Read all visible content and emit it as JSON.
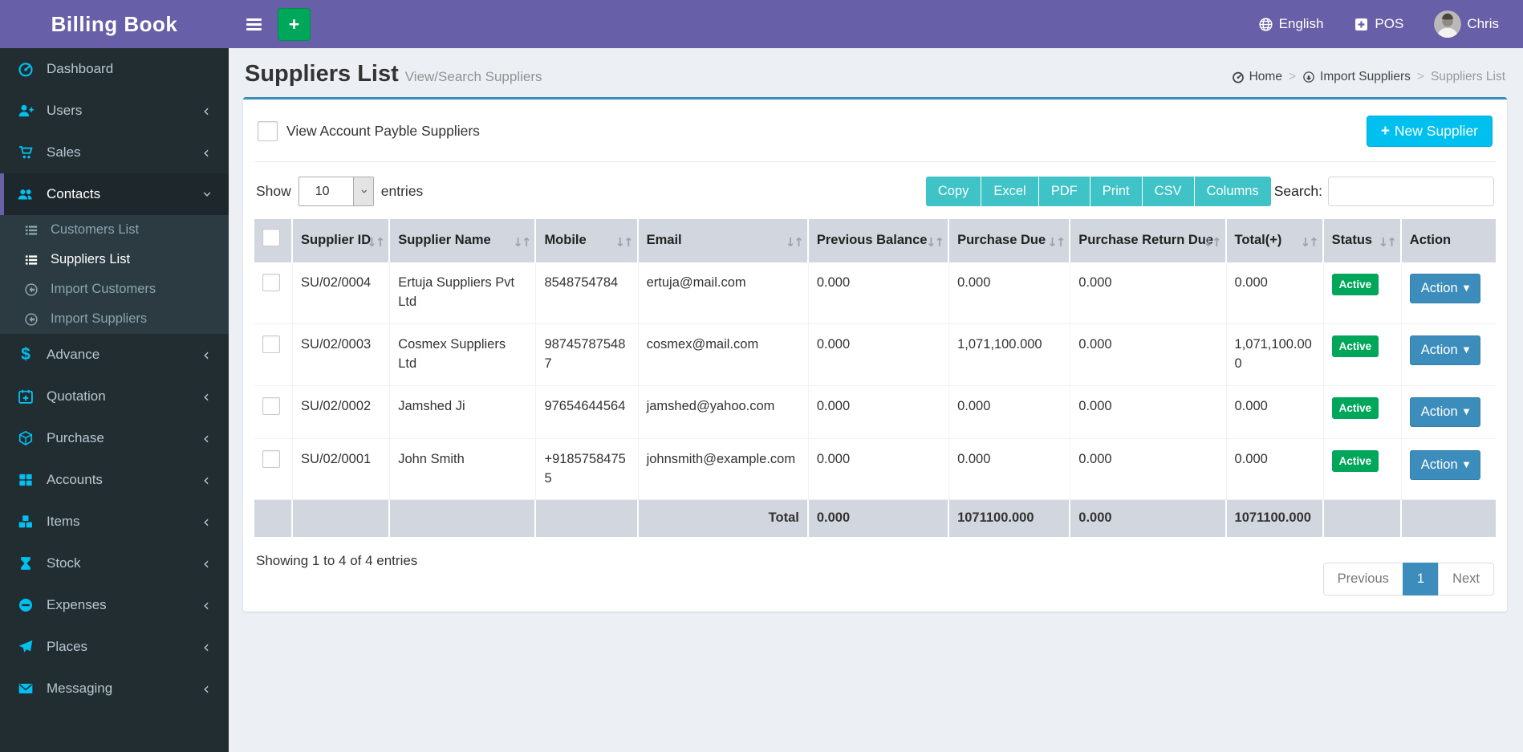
{
  "app": {
    "title": "Billing Book"
  },
  "navbar": {
    "quick_add_label": "+",
    "language": "English",
    "pos": "POS",
    "user": "Chris"
  },
  "sidebar": {
    "items": [
      {
        "label": "Dashboard",
        "icon": "dashboard-icon",
        "has_children": false,
        "active": false
      },
      {
        "label": "Users",
        "icon": "user-plus-icon",
        "has_children": true,
        "active": false
      },
      {
        "label": "Sales",
        "icon": "cart-icon",
        "has_children": true,
        "active": false
      },
      {
        "label": "Contacts",
        "icon": "contacts-icon",
        "has_children": true,
        "active": true,
        "expanded": true,
        "children": [
          {
            "label": "Customers List",
            "icon": "list-icon",
            "active": false
          },
          {
            "label": "Suppliers List",
            "icon": "list-icon",
            "active": true
          },
          {
            "label": "Import Customers",
            "icon": "import-icon",
            "active": false
          },
          {
            "label": "Import Suppliers",
            "icon": "import-icon",
            "active": false
          }
        ]
      },
      {
        "label": "Advance",
        "icon": "dollar-icon",
        "has_children": true,
        "active": false
      },
      {
        "label": "Quotation",
        "icon": "calendar-plus-icon",
        "has_children": true,
        "active": false
      },
      {
        "label": "Purchase",
        "icon": "cube-icon",
        "has_children": true,
        "active": false
      },
      {
        "label": "Accounts",
        "icon": "grid-icon",
        "has_children": true,
        "active": false
      },
      {
        "label": "Items",
        "icon": "cubes-icon",
        "has_children": true,
        "active": false
      },
      {
        "label": "Stock",
        "icon": "hourglass-icon",
        "has_children": true,
        "active": false
      },
      {
        "label": "Expenses",
        "icon": "minus-circle-icon",
        "has_children": true,
        "active": false
      },
      {
        "label": "Places",
        "icon": "send-icon",
        "has_children": true,
        "active": false
      },
      {
        "label": "Messaging",
        "icon": "envelope-icon",
        "has_children": true,
        "active": false
      }
    ]
  },
  "page": {
    "title": "Suppliers List",
    "subtitle": "View/Search Suppliers",
    "breadcrumb": [
      {
        "label": "Home",
        "icon": "gauge-icon"
      },
      {
        "label": "Import Suppliers",
        "icon": "import-circle-icon"
      },
      {
        "label": "Suppliers List",
        "icon": null
      }
    ]
  },
  "controls": {
    "payble_checkbox_label": "View Account Payble Suppliers",
    "payble_checkbox_checked": false,
    "new_supplier_label": "New Supplier",
    "show_label": "Show",
    "entries_label": "entries",
    "page_length": "10",
    "export_buttons": [
      "Copy",
      "Excel",
      "PDF",
      "Print",
      "CSV",
      "Columns"
    ],
    "search_label": "Search:",
    "search_value": ""
  },
  "table": {
    "columns": [
      {
        "key": "checkbox",
        "label": "",
        "sortable": false
      },
      {
        "key": "supplier_id",
        "label": "Supplier ID",
        "sortable": true
      },
      {
        "key": "supplier_name",
        "label": "Supplier Name",
        "sortable": true
      },
      {
        "key": "mobile",
        "label": "Mobile",
        "sortable": true
      },
      {
        "key": "email",
        "label": "Email",
        "sortable": true
      },
      {
        "key": "previous_balance",
        "label": "Previous Balance",
        "sortable": true
      },
      {
        "key": "purchase_due",
        "label": "Purchase Due",
        "sortable": true
      },
      {
        "key": "purchase_return_due",
        "label": "Purchase Return Due",
        "sortable": true
      },
      {
        "key": "total_plus",
        "label": "Total(+)",
        "sortable": true
      },
      {
        "key": "status",
        "label": "Status",
        "sortable": true
      },
      {
        "key": "action",
        "label": "Action",
        "sortable": false
      }
    ],
    "rows": [
      {
        "supplier_id": "SU/02/0004",
        "supplier_name": "Ertuja Suppliers Pvt Ltd",
        "mobile": "8548754784",
        "email": "ertuja@mail.com",
        "previous_balance": "0.000",
        "purchase_due": "0.000",
        "purchase_return_due": "0.000",
        "total_plus": "0.000",
        "status": "Active",
        "action_label": "Action"
      },
      {
        "supplier_id": "SU/02/0003",
        "supplier_name": "Cosmex Suppliers Ltd",
        "mobile": "987457875487",
        "email": "cosmex@mail.com",
        "previous_balance": "0.000",
        "purchase_due": "1,071,100.000",
        "purchase_return_due": "0.000",
        "total_plus": "1,071,100.000",
        "status": "Active",
        "action_label": "Action"
      },
      {
        "supplier_id": "SU/02/0002",
        "supplier_name": "Jamshed Ji",
        "mobile": "97654644564",
        "email": "jamshed@yahoo.com",
        "previous_balance": "0.000",
        "purchase_due": "0.000",
        "purchase_return_due": "0.000",
        "total_plus": "0.000",
        "status": "Active",
        "action_label": "Action"
      },
      {
        "supplier_id": "SU/02/0001",
        "supplier_name": "John Smith",
        "mobile": "+91857584755",
        "email": "johnsmith@example.com",
        "previous_balance": "0.000",
        "purchase_due": "0.000",
        "purchase_return_due": "0.000",
        "total_plus": "0.000",
        "status": "Active",
        "action_label": "Action"
      }
    ],
    "total_row": {
      "label": "Total",
      "previous_balance": "0.000",
      "purchase_due": "1071100.000",
      "purchase_return_due": "0.000",
      "total_plus": "1071100.000"
    },
    "footer": {
      "showing_text": "Showing 1 to 4 of 4 entries",
      "pagination": {
        "previous": "Previous",
        "current_page": "1",
        "next": "Next"
      }
    }
  },
  "colors": {
    "navbar_purple": "#6760A8",
    "sidebar_bg": "#222D32",
    "accent_cyan": "#00C0EF",
    "teal_export_button": "#3FC3C6",
    "green_badge": "#00A65A",
    "blue_action_button": "#3C8DBC",
    "table_header_bg": "#D2D6DE",
    "content_bg": "#ECF0F5",
    "box_top_border": "#3C8DBC"
  }
}
